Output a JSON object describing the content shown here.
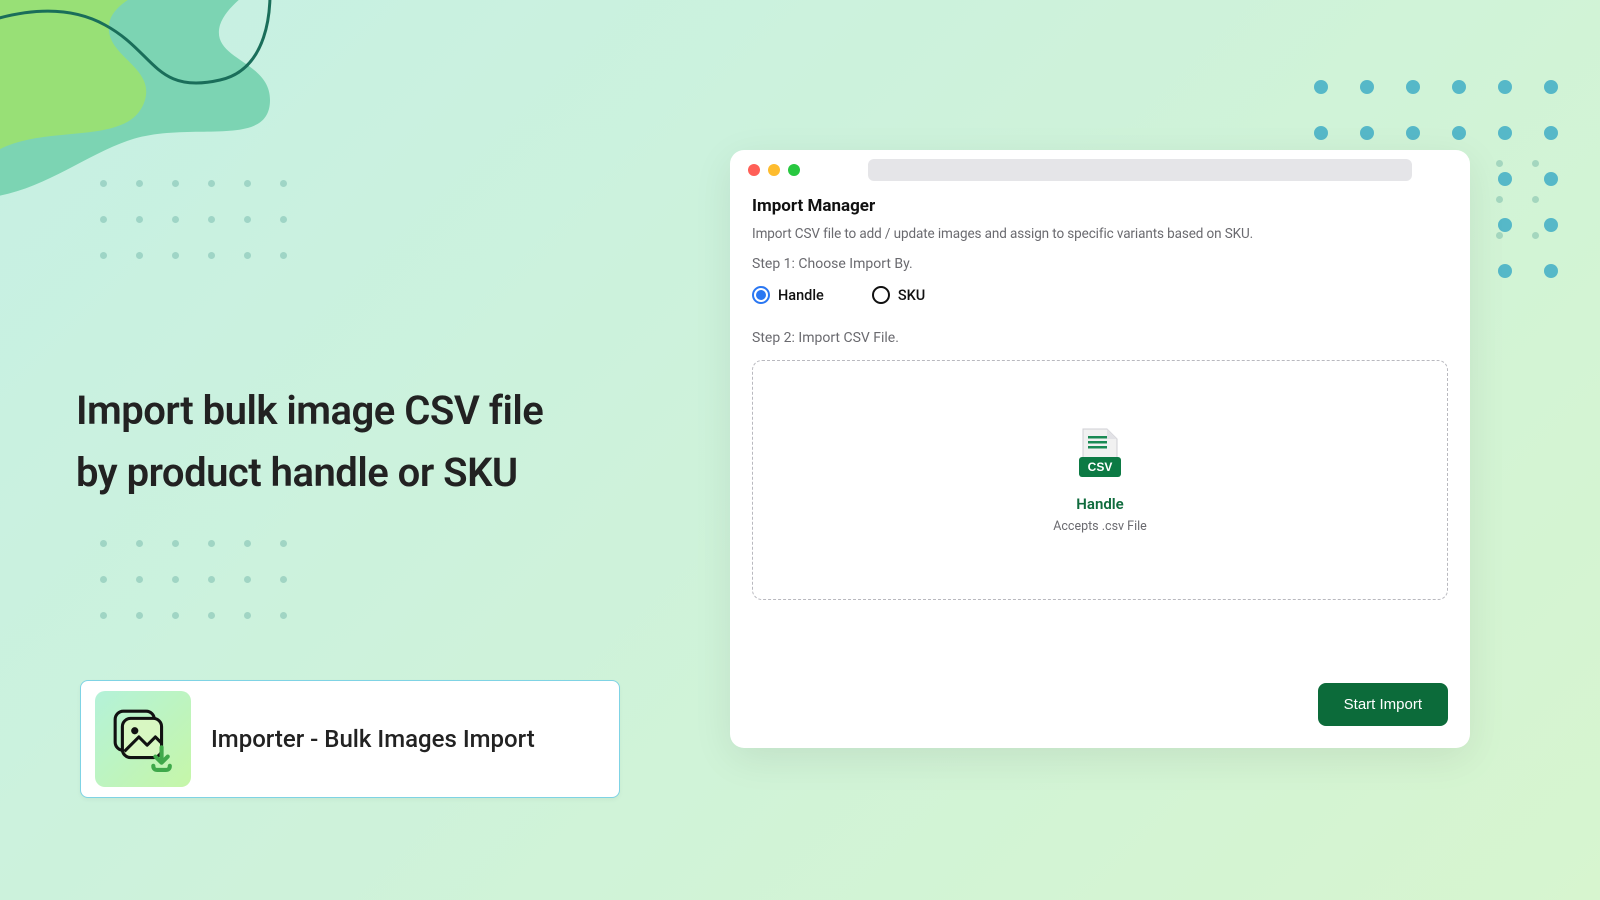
{
  "hero": {
    "title_line1": "Import bulk image CSV file",
    "title_line2": "by product handle or SKU"
  },
  "app_card": {
    "title": "Importer - Bulk Images Import",
    "icon_name": "gallery-download-icon"
  },
  "browser": {
    "dots": [
      "close",
      "minimize",
      "maximize"
    ]
  },
  "import_manager": {
    "title": "Import Manager",
    "subtitle": "Import CSV file to add / update images and assign to specific  variants based on SKU.",
    "step1_label": "Step 1: Choose Import By.",
    "options": [
      {
        "label": "Handle",
        "selected": true
      },
      {
        "label": "SKU",
        "selected": false
      }
    ],
    "step2_label": "Step 2: Import CSV File.",
    "dropzone": {
      "label": "Handle",
      "sublabel": "Accepts .csv File",
      "file_type_badge": "CSV"
    },
    "start_button": "Start Import"
  },
  "colors": {
    "accent_green": "#0c6b3a",
    "radio_blue": "#2a77f2",
    "teal_dot": "#56b8c8"
  }
}
